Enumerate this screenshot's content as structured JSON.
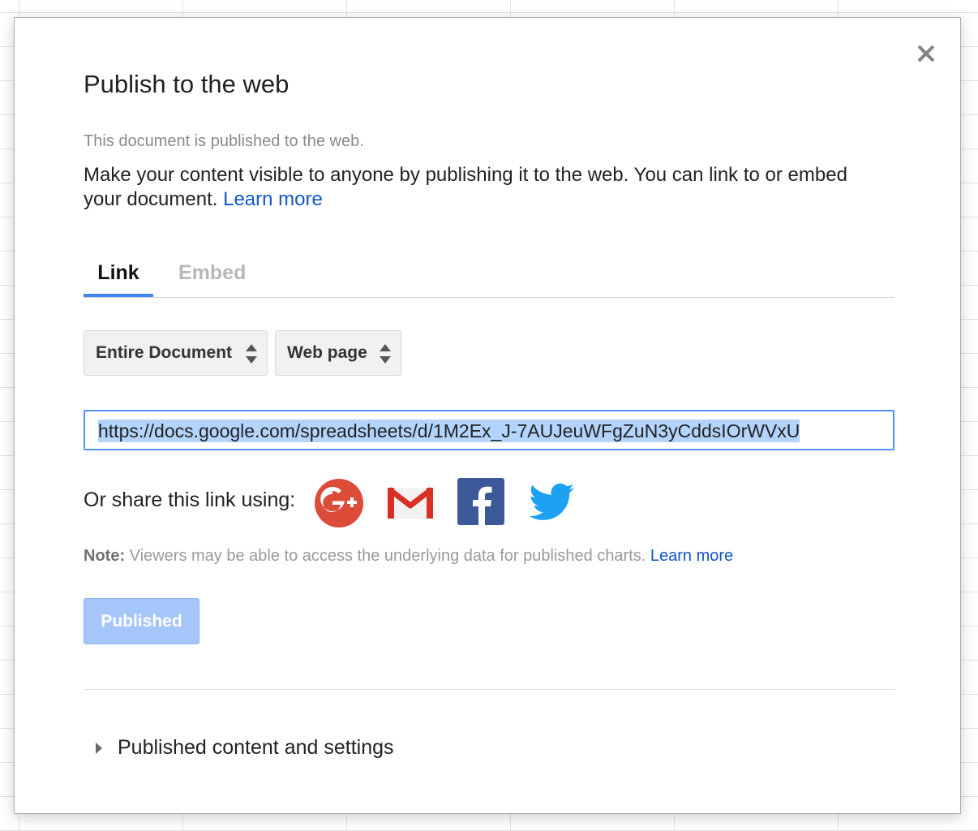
{
  "dialog": {
    "title": "Publish to the web",
    "status": "This document is published to the web.",
    "description": "Make your content visible to anyone by publishing it to the web. You can link to or embed your document.",
    "learn_more": "Learn more",
    "tabs": [
      {
        "label": "Link",
        "active": true
      },
      {
        "label": "Embed",
        "active": false
      }
    ],
    "scope_select": {
      "value": "Entire Document"
    },
    "format_select": {
      "value": "Web page"
    },
    "url": "https://docs.google.com/spreadsheets/d/1M2Ex_J-7AUJeuWFgZuN3yCddsIOrWVxU",
    "share_label": "Or share this link using:",
    "share_icons": [
      "google-plus-icon",
      "gmail-icon",
      "facebook-icon",
      "twitter-icon"
    ],
    "note_label": "Note:",
    "note_text": "Viewers may be able to access the underlying data for published charts.",
    "note_learn_more": "Learn more",
    "published_button": "Published",
    "published_settings": "Published content and settings"
  },
  "colors": {
    "accent": "#4285f4",
    "link": "#1155cc",
    "published_button_bg": "#a5c5fb",
    "google_plus": "#dd4b39",
    "gmail": "#d93025",
    "facebook": "#3b5998",
    "twitter": "#1da1f2"
  }
}
